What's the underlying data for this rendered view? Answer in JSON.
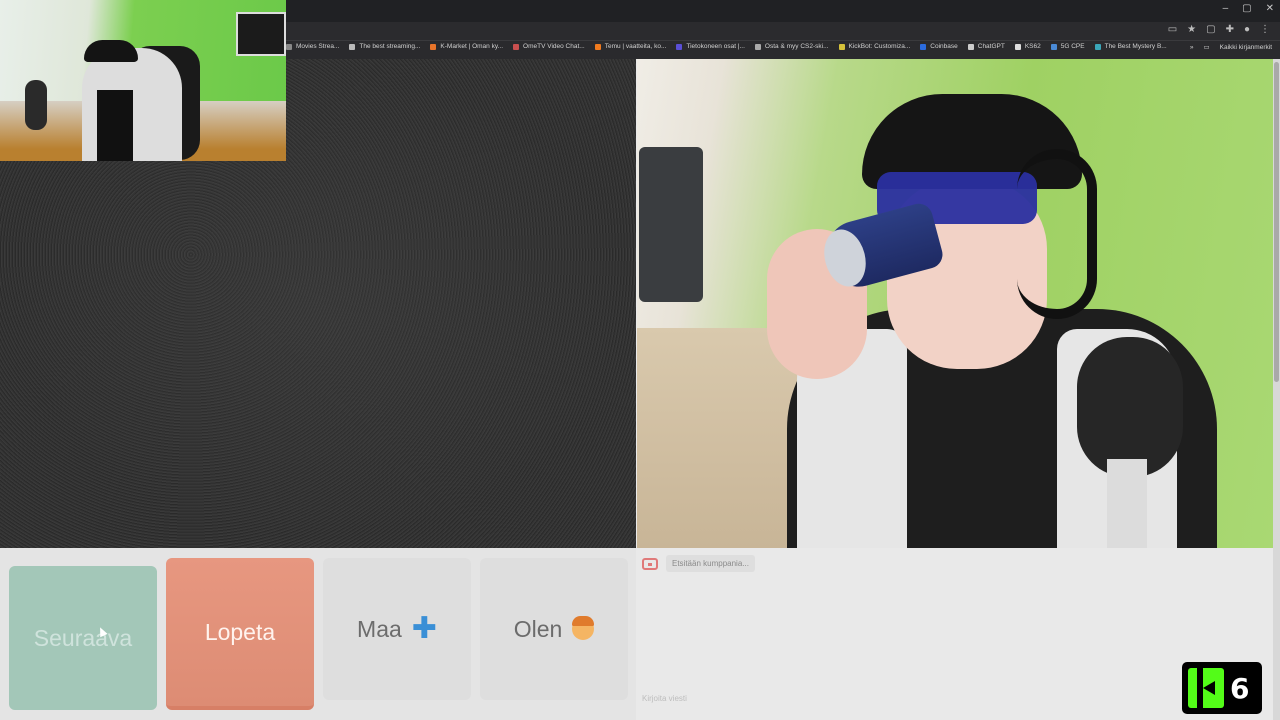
{
  "browser": {
    "window_controls": [
      "–",
      "▢",
      "✕"
    ],
    "toolbar_icons": [
      "cast-icon",
      "star-icon",
      "extensions-icon",
      "puzzle-icon",
      "profile-icon",
      "menu-icon"
    ],
    "bookmarks": [
      {
        "label": "Movies Strea...",
        "color": "#888888"
      },
      {
        "label": "The best streaming...",
        "color": "#bbbbbb"
      },
      {
        "label": "K-Market | Oman ky...",
        "color": "#e8742a"
      },
      {
        "label": "OmeTV Video Chat...",
        "color": "#c94f4f"
      },
      {
        "label": "Temu | vaatteita, ko...",
        "color": "#f07a1e"
      },
      {
        "label": "Tietokoneen osat |...",
        "color": "#5a4fd6"
      },
      {
        "label": "Osta & myy CS2-ski...",
        "color": "#aaaaaa"
      },
      {
        "label": "KickBot: Customiza...",
        "color": "#d6c23a"
      },
      {
        "label": "Coinbase",
        "color": "#2b6bde"
      },
      {
        "label": "ChatGPT",
        "color": "#cccccc"
      },
      {
        "label": "KS62",
        "color": "#dddddd"
      },
      {
        "label": "5G CPE",
        "color": "#4a8ad6"
      },
      {
        "label": "The Best Mystery B...",
        "color": "#3aa6b8"
      }
    ],
    "bookmarks_overflow": "»",
    "all_bookmarks": "Kaikki kirjanmerkit"
  },
  "controls": {
    "next_label": "Seuraava",
    "stop_label": "Lopeta",
    "country_label": "Maa",
    "country_icon": "plus-icon",
    "gender_label": "Olen",
    "gender_icon": "person-emoji-icon"
  },
  "chat": {
    "status": "Etsitään kumppania...",
    "input_placeholder": "Kirjoita viesti"
  },
  "logo": {
    "number": "6"
  }
}
